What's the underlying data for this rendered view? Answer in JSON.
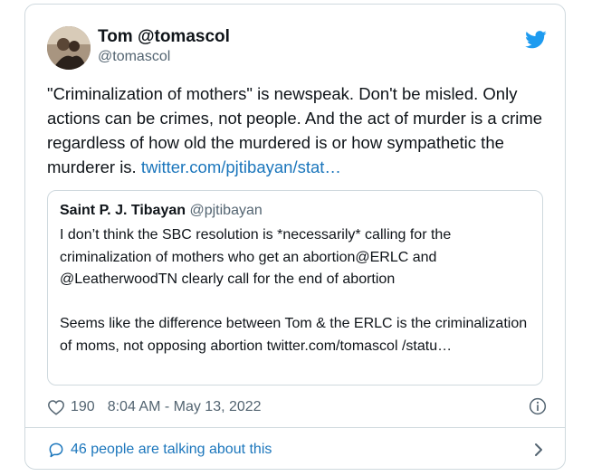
{
  "tweet": {
    "author_name": "Tom @tomascol",
    "author_handle": "@tomascol",
    "text": "\"Criminalization of mothers\" is newspeak. Don't be misled. Only actions can be crimes, not people. And the act of murder is a crime regardless of how old the murdered is or how sympathetic the murderer is.",
    "link": "twitter.com/pjtibayan/stat…",
    "likes": "190",
    "timestamp": "8:04 AM - May 13, 2022"
  },
  "quote": {
    "author_name": "Saint P. J. Tibayan",
    "author_handle": "@pjtibayan",
    "text": "I don’t think the SBC resolution is *necessarily* calling for the criminalization of mothers who get an abortion@ERLC and @LeatherwoodTN clearly call for the end of abortion\n\nSeems like the difference between Tom & the ERLC is the criminalization of moms, not opposing abortion twitter.com/tomascol /statu…"
  },
  "footer": {
    "talking_label": "46 people are talking about this"
  },
  "colors": {
    "link": "#1b76bc",
    "twitter_blue": "#1d9bf0",
    "muted": "#536471",
    "border": "#cfd9de"
  },
  "icons": [
    "avatar",
    "twitter-bird-icon",
    "heart-icon",
    "info-icon",
    "chat-bubble-icon",
    "chevron-right-icon"
  ]
}
